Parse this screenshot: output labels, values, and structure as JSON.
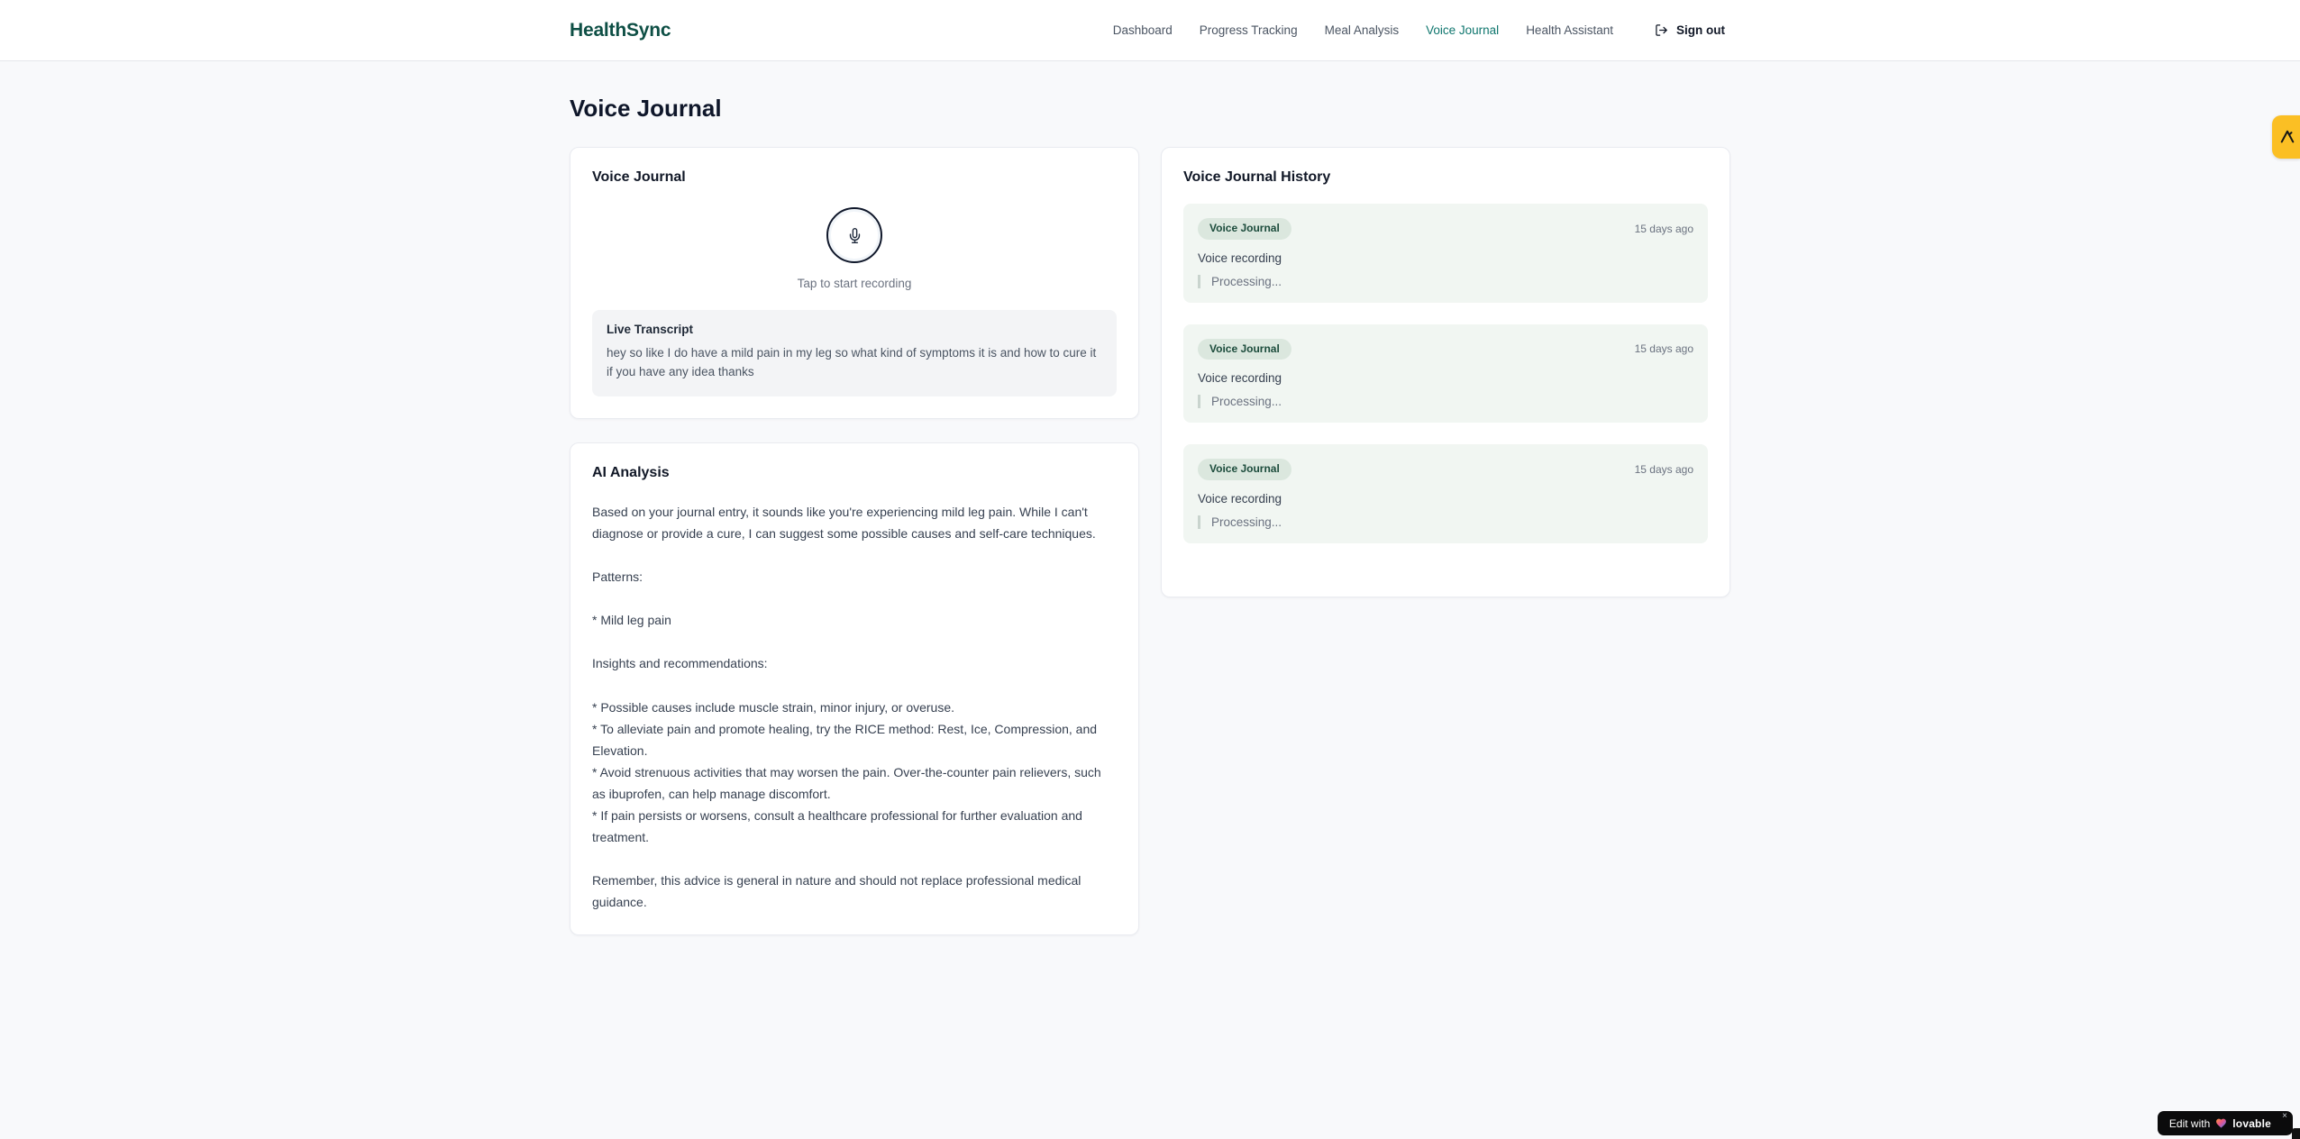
{
  "header": {
    "logo": "HealthSync",
    "nav": [
      {
        "label": "Dashboard",
        "active": false
      },
      {
        "label": "Progress Tracking",
        "active": false
      },
      {
        "label": "Meal Analysis",
        "active": false
      },
      {
        "label": "Voice Journal",
        "active": true
      },
      {
        "label": "Health Assistant",
        "active": false
      }
    ],
    "sign_out_label": "Sign out"
  },
  "page_title": "Voice Journal",
  "recorder": {
    "title": "Voice Journal",
    "tap_label": "Tap to start recording",
    "transcript_title": "Live Transcript",
    "transcript_text": "hey so like I do have a mild pain in my leg so what kind of symptoms it is and how to cure it if you have any idea thanks"
  },
  "analysis": {
    "title": "AI Analysis",
    "body": "Based on your journal entry, it sounds like you're experiencing mild leg pain. While I can't diagnose or provide a cure, I can suggest some possible causes and self-care techniques.\n\nPatterns:\n\n* Mild leg pain\n\nInsights and recommendations:\n\n* Possible causes include muscle strain, minor injury, or overuse.\n* To alleviate pain and promote healing, try the RICE method: Rest, Ice, Compression, and Elevation.\n* Avoid strenuous activities that may worsen the pain. Over-the-counter pain relievers, such as ibuprofen, can help manage discomfort.\n* If pain persists or worsens, consult a healthcare professional for further evaluation and treatment.\n\nRemember, this advice is general in nature and should not replace professional medical guidance."
  },
  "history": {
    "title": "Voice Journal History",
    "entries": [
      {
        "badge": "Voice Journal",
        "time": "15 days ago",
        "label": "Voice recording",
        "status": "Processing..."
      },
      {
        "badge": "Voice Journal",
        "time": "15 days ago",
        "label": "Voice recording",
        "status": "Processing..."
      },
      {
        "badge": "Voice Journal",
        "time": "15 days ago",
        "label": "Voice recording",
        "status": "Processing..."
      }
    ]
  },
  "badges": {
    "edit_prefix": "Edit with",
    "brand": "lovable",
    "close": "×"
  },
  "colors": {
    "brand_teal": "#0e4f45",
    "nav_active_teal": "#0f766e",
    "history_entry_bg": "#f1f6f2",
    "badge_pill_bg": "#dbe7de",
    "badge_pill_text": "#1c4c3c",
    "side_badge_amber": "#fbbf24",
    "lovable_bg": "#0b0b0c"
  }
}
